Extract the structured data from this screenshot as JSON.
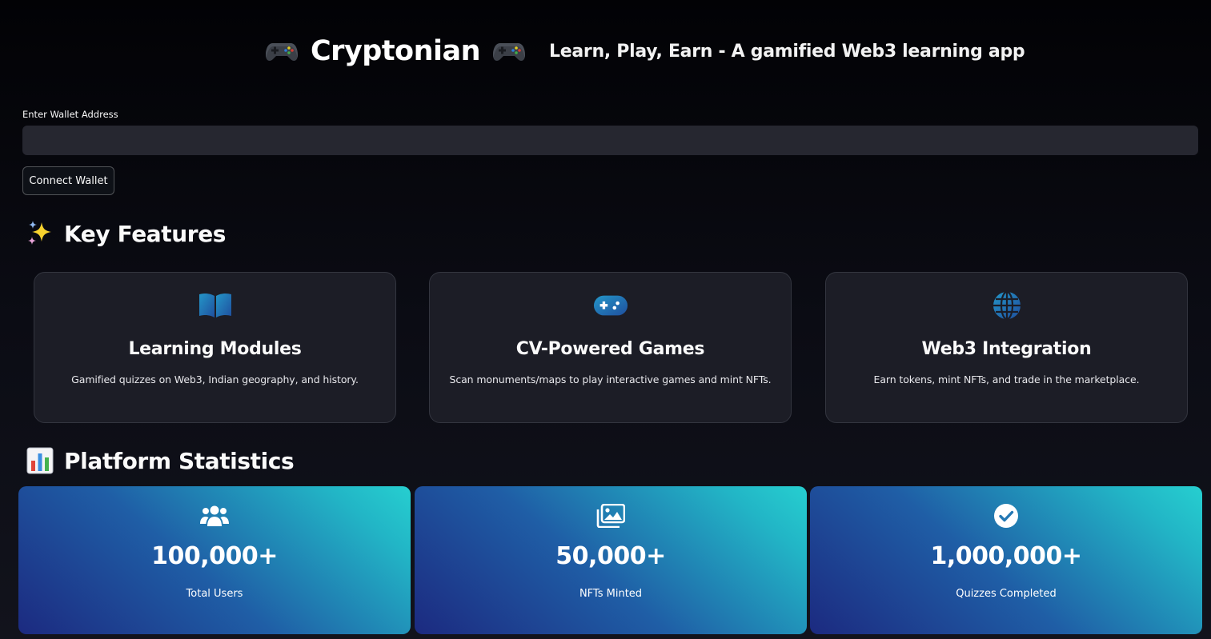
{
  "header": {
    "title": "Cryptonian",
    "tagline": "Learn, Play, Earn - A gamified Web3 learning app",
    "left_emoji_icon": "video-game-controller-icon",
    "right_emoji_icon": "video-game-controller-icon"
  },
  "wallet": {
    "label": "Enter Wallet Address",
    "value": "",
    "placeholder": "",
    "button_label": "Connect Wallet"
  },
  "features": {
    "heading": "Key Features",
    "heading_icon": "sparkles-icon",
    "cards": [
      {
        "icon": "book-icon",
        "title": "Learning Modules",
        "description": "Gamified quizzes on Web3, Indian geography, and history."
      },
      {
        "icon": "gamepad-icon",
        "title": "CV-Powered Games",
        "description": "Scan monuments/maps to play interactive games and mint NFTs."
      },
      {
        "icon": "globe-icon",
        "title": "Web3 Integration",
        "description": "Earn tokens, mint NFTs, and trade in the marketplace."
      }
    ]
  },
  "statistics": {
    "heading": "Platform Statistics",
    "heading_icon": "bar-chart-icon",
    "cards": [
      {
        "icon": "users-icon",
        "value": "100,000+",
        "label": "Total Users"
      },
      {
        "icon": "images-icon",
        "value": "50,000+",
        "label": "NFTs Minted"
      },
      {
        "icon": "check-circle-icon",
        "value": "1,000,000+",
        "label": "Quizzes Completed"
      }
    ]
  },
  "colors": {
    "background": "#0b0c14",
    "card_background": "#1c1d26",
    "input_background": "#262730",
    "icon_gradient_start": "#1f4f9e",
    "icon_gradient_end": "#22b5c6",
    "stat_gradient_start": "#1c2a80",
    "stat_gradient_end": "#26cfd0"
  }
}
